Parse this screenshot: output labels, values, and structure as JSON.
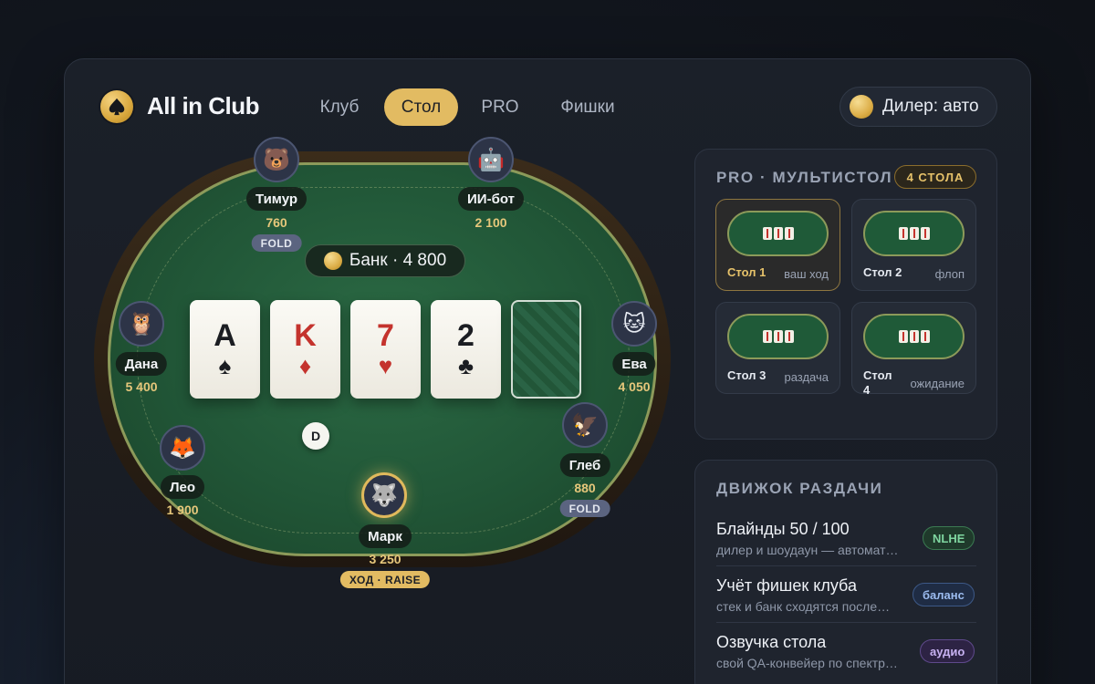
{
  "header": {
    "brand": "All in Club",
    "nav": [
      {
        "label": "Клуб",
        "active": false
      },
      {
        "label": "Стол",
        "active": true
      },
      {
        "label": "PRO",
        "active": false
      },
      {
        "label": "Фишки",
        "active": false
      }
    ],
    "dealer_label": "Дилер: авто"
  },
  "table": {
    "pot_label": "Банк · 4 800",
    "dealer_button": "D",
    "board": [
      {
        "rank": "A",
        "suit": "♠",
        "color": "black"
      },
      {
        "rank": "K",
        "suit": "♦",
        "color": "red"
      },
      {
        "rank": "7",
        "suit": "♥",
        "color": "red"
      },
      {
        "rank": "2",
        "suit": "♣",
        "color": "black"
      },
      {
        "rank": "",
        "suit": "",
        "color": "back"
      }
    ],
    "players": [
      {
        "name": "Тимур",
        "stack": "760",
        "avatar": "🐻",
        "avatar_name": "bear-icon",
        "badge": "FOLD"
      },
      {
        "name": "ИИ-бот",
        "stack": "2 100",
        "avatar": "🤖",
        "avatar_name": "robot-icon",
        "badge": ""
      },
      {
        "name": "Дана",
        "stack": "5 400",
        "avatar": "🦉",
        "avatar_name": "owl-icon",
        "badge": ""
      },
      {
        "name": "Ева",
        "stack": "4 050",
        "avatar": "🐱",
        "avatar_name": "cat-icon",
        "badge": ""
      },
      {
        "name": "Лео",
        "stack": "1 900",
        "avatar": "🦊",
        "avatar_name": "fox-icon",
        "badge": ""
      },
      {
        "name": "Глеб",
        "stack": "880",
        "avatar": "🦅",
        "avatar_name": "eagle-icon",
        "badge": "FOLD"
      },
      {
        "name": "Марк",
        "stack": "3 250",
        "avatar": "🐺",
        "avatar_name": "wolf-icon",
        "badge": "ХОД · RAISE"
      }
    ]
  },
  "multitable": {
    "title": "PRO · МУЛЬТИСТОЛ",
    "count_badge": "4 СТОЛА",
    "tables": [
      {
        "name": "Стол 1",
        "status": "ваш ход",
        "active": true
      },
      {
        "name": "Стол 2",
        "status": "флоп",
        "active": false
      },
      {
        "name": "Стол 3",
        "status": "раздача",
        "active": false
      },
      {
        "name": "Стол 4",
        "status": "ожидание",
        "active": false
      }
    ]
  },
  "engine": {
    "title": "ДВИЖОК РАЗДАЧИ",
    "items": [
      {
        "title": "Блайнды 50 / 100",
        "subtitle": "дилер и шоудаун — автомат…",
        "tag": "NLHE",
        "tag_color": "green"
      },
      {
        "title": "Учёт фишек клуба",
        "subtitle": "стек и банк сходятся после…",
        "tag": "баланс",
        "tag_color": "blue"
      },
      {
        "title": "Озвучка стола",
        "subtitle": "свой QA-конвейер по спектр…",
        "tag": "аудио",
        "tag_color": "purple"
      }
    ]
  },
  "colors": {
    "accent_gold": "#e2bb62",
    "felt_green": "#215637",
    "panel_bg": "#1b2029"
  }
}
